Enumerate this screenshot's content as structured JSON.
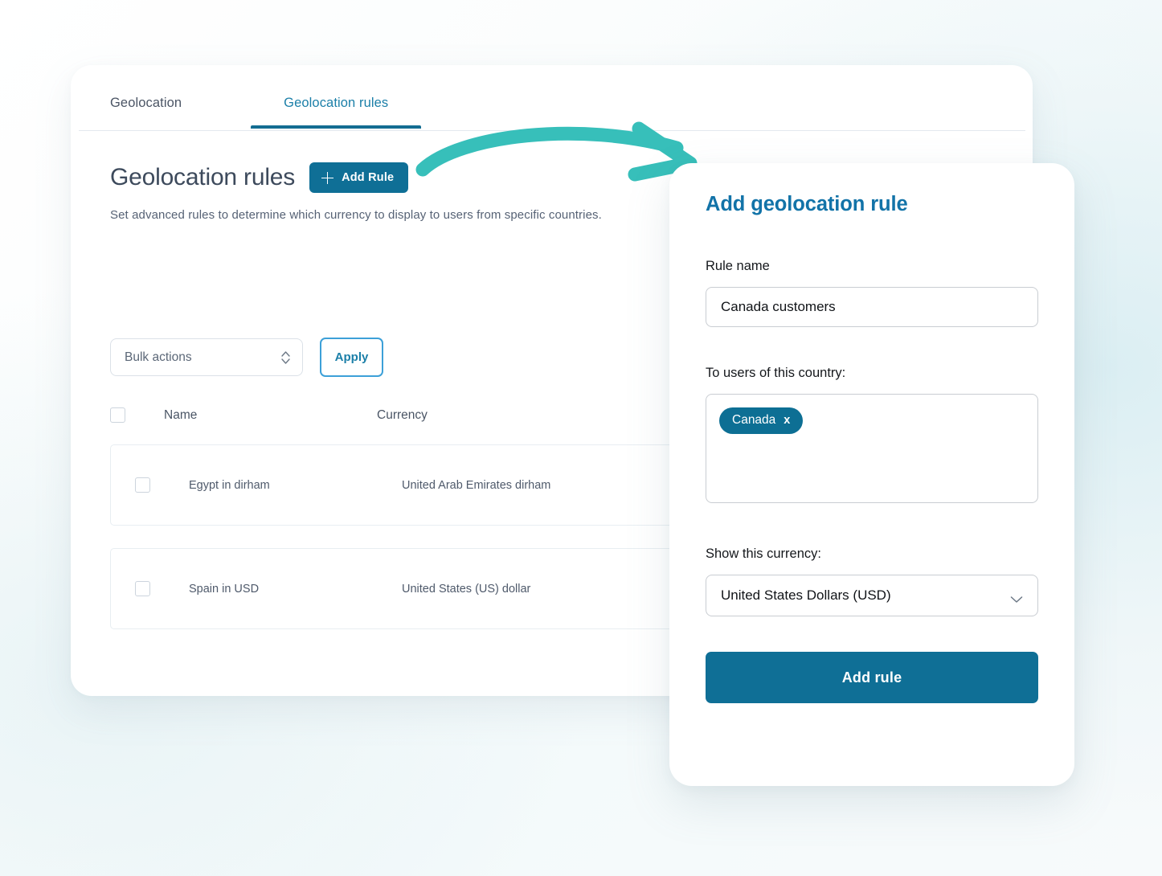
{
  "theme": {
    "primary_blue": "#0f6f96",
    "link_blue": "#1b7fa8",
    "heading_blue": "#1273a8",
    "arrow_teal": "#37bfba",
    "tag_blue": "#0d6f94",
    "text_slate": "#4a5565"
  },
  "tabs": [
    {
      "label": "Geolocation",
      "active": false
    },
    {
      "label": "Geolocation rules",
      "active": true
    }
  ],
  "page": {
    "title": "Geolocation rules",
    "add_rule_button": "Add Rule",
    "subtitle": "Set advanced rules to determine which currency to display to users from specific countries."
  },
  "bulk": {
    "select_value": "Bulk actions",
    "apply_label": "Apply"
  },
  "table": {
    "columns": [
      "Name",
      "Currency"
    ],
    "rows": [
      {
        "name": "Egypt in dirham",
        "currency": "United Arab Emirates dirham"
      },
      {
        "name": "Spain in USD",
        "currency": "United States (US) dollar"
      }
    ]
  },
  "panel": {
    "title": "Add geolocation rule",
    "rule_name_label": "Rule name",
    "rule_name_value": "Canada customers",
    "rule_name_placeholder": "Rule name",
    "country_label": "To users of this country:",
    "country_tags": [
      {
        "label": "Canada",
        "remove": "x"
      }
    ],
    "currency_label": "Show this currency:",
    "currency_value": "United States Dollars (USD)",
    "submit_label": "Add rule"
  }
}
